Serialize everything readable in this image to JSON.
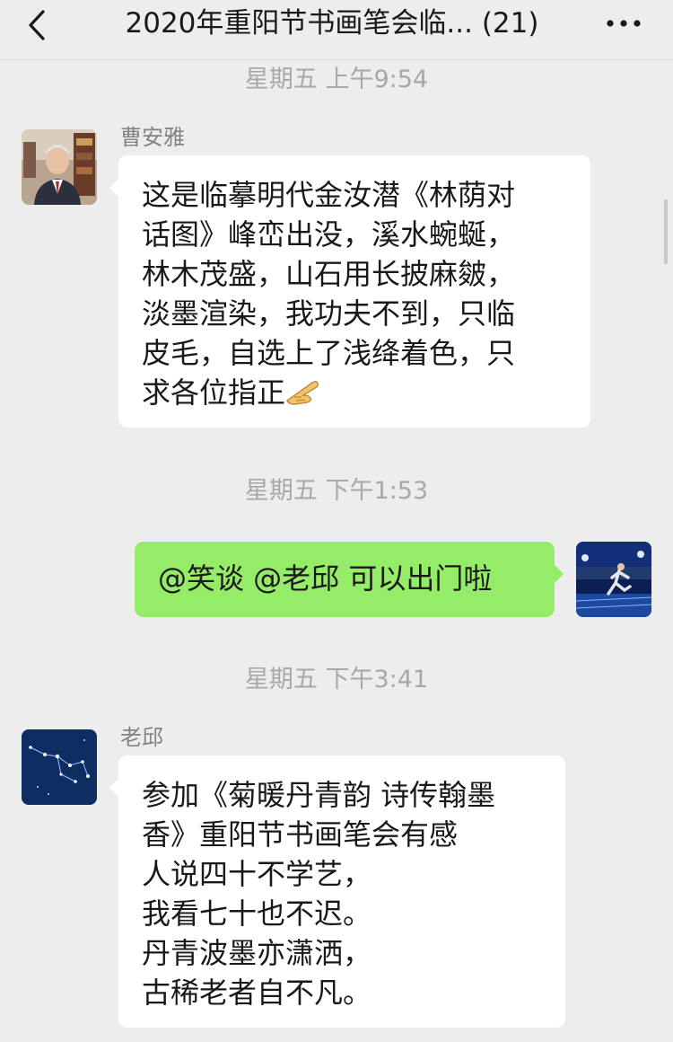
{
  "header": {
    "title": "2020年重阳节书画笔会临... (21)",
    "back_icon": "chevron-left-icon",
    "more_icon": "more-dots-icon"
  },
  "messages": [
    {
      "time": "星期五 上午9:54",
      "sender": "曹安雅",
      "avatar": "person-photo-avatar",
      "lines": [
        "这是临摹明代金汝潜《林荫对",
        "话图》峰峦出没，溪水蜿蜒，",
        "林木茂盛，山石用长披麻皴，",
        "淡墨渲染，我功夫不到，只临",
        "皮毛，自选上了浅绛着色，只",
        "求各位指正"
      ],
      "emoji": "pointing-hand-emoji"
    },
    {
      "time": "星期五 下午1:53",
      "text": "@笑谈 @老邱 可以出门啦",
      "avatar": "runner-stadium-avatar"
    },
    {
      "time": "星期五 下午3:41",
      "sender": "老邱",
      "avatar": "constellation-avatar",
      "lines": [
        "参加《菊暖丹青韵 诗传翰墨",
        "香》重阳节书画笔会有感",
        "人说四十不学艺，",
        "我看七十也不迟。",
        "丹青波墨亦潇洒，",
        "古稀老者自不凡。"
      ]
    }
  ]
}
